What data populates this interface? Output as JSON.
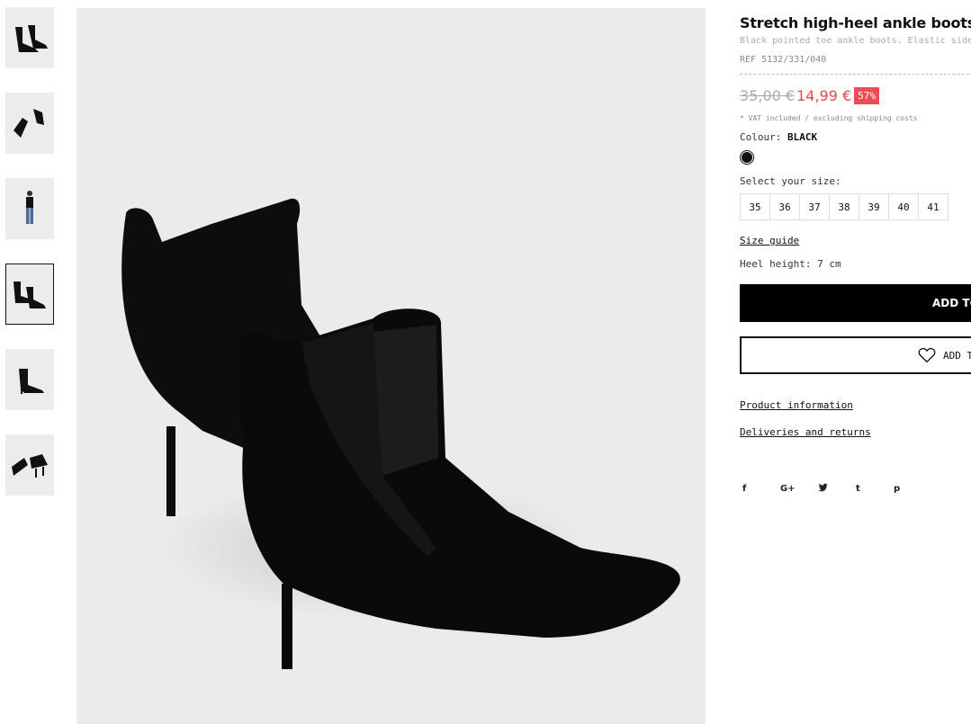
{
  "thumbnails": [
    {
      "name": "thumb-boots-side",
      "active": false
    },
    {
      "name": "thumb-boots-top",
      "active": false
    },
    {
      "name": "thumb-model",
      "active": false
    },
    {
      "name": "thumb-boots-pair",
      "active": true
    },
    {
      "name": "thumb-boot-single",
      "active": false
    },
    {
      "name": "thumb-boots-back",
      "active": false
    }
  ],
  "product": {
    "title": "Stretch high-heel ankle boots",
    "subtitle": "Black pointed toe ankle boots. Elastic side panels. Black",
    "ref": "REF 5132/331/040",
    "old_price": "35,00 €",
    "new_price": "14,99 €",
    "discount": "57%",
    "vat_note": "* VAT included / excluding shipping costs",
    "colour_label": "Colour:",
    "colour_value": "BLACK",
    "swatch_color": "#111111",
    "size_label": "Select your size:",
    "sizes": [
      "35",
      "36",
      "37",
      "38",
      "39",
      "40",
      "41"
    ],
    "size_guide": "Size guide",
    "heel_height": "Heel height: 7 cm",
    "add_to_cart": "ADD TO",
    "add_to_wishlist": "ADD T",
    "product_information": "Product information",
    "deliveries_returns": "Deliveries and returns"
  },
  "social": [
    "f",
    "G+",
    "t-bird",
    "t",
    "p"
  ],
  "social_labels": {
    "facebook": "f",
    "google": "G+",
    "tumblr": "t",
    "pinterest": "p"
  }
}
